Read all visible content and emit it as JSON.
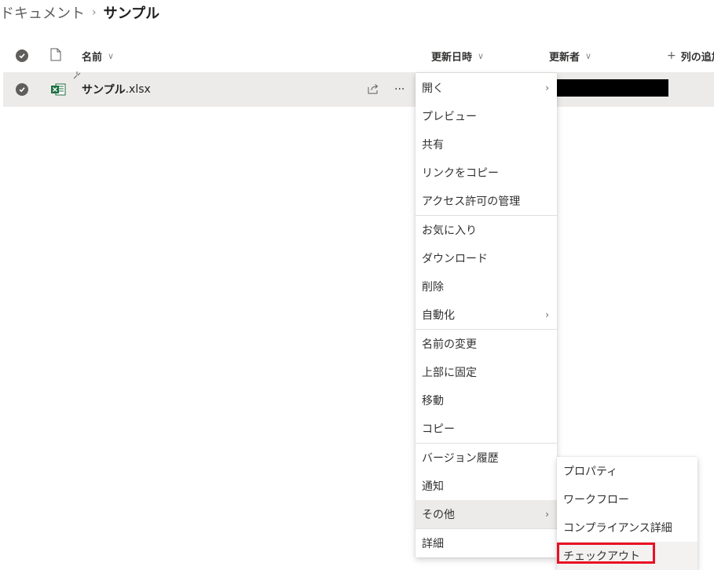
{
  "breadcrumb": {
    "parent": "ドキュメント",
    "separator": "›",
    "current": "サンプル"
  },
  "header": {
    "name": "名前",
    "modified": "更新日時",
    "modified_by": "更新者",
    "add_column": "列の追加",
    "chevron": "∨",
    "plus": "+"
  },
  "file": {
    "name": "サンプル",
    "extension": ".xlsx",
    "icon": "excel-file-icon",
    "more": "···"
  },
  "context_menu": {
    "items": [
      {
        "label": "開く",
        "submenu": true
      },
      {
        "label": "プレビュー"
      },
      {
        "label": "共有"
      },
      {
        "label": "リンクをコピー"
      },
      {
        "label": "アクセス許可の管理"
      },
      {
        "label": "お気に入り"
      },
      {
        "label": "ダウンロード"
      },
      {
        "label": "削除"
      },
      {
        "label": "自動化",
        "submenu": true
      },
      {
        "label": "名前の変更"
      },
      {
        "label": "上部に固定"
      },
      {
        "label": "移動"
      },
      {
        "label": "コピー"
      },
      {
        "label": "バージョン履歴"
      },
      {
        "label": "通知"
      },
      {
        "label": "その他",
        "submenu": true,
        "hovered": true
      },
      {
        "label": "詳細"
      }
    ],
    "sub_chevron": "›"
  },
  "sub_menu": {
    "items": [
      {
        "label": "プロパティ"
      },
      {
        "label": "ワークフロー"
      },
      {
        "label": "コンプライアンス詳細"
      },
      {
        "label": "チェックアウト",
        "highlighted": true
      }
    ]
  },
  "colors": {
    "excel_green": "#1d6f42",
    "highlight_red": "#e81123",
    "hover_bg": "#edebe9"
  }
}
